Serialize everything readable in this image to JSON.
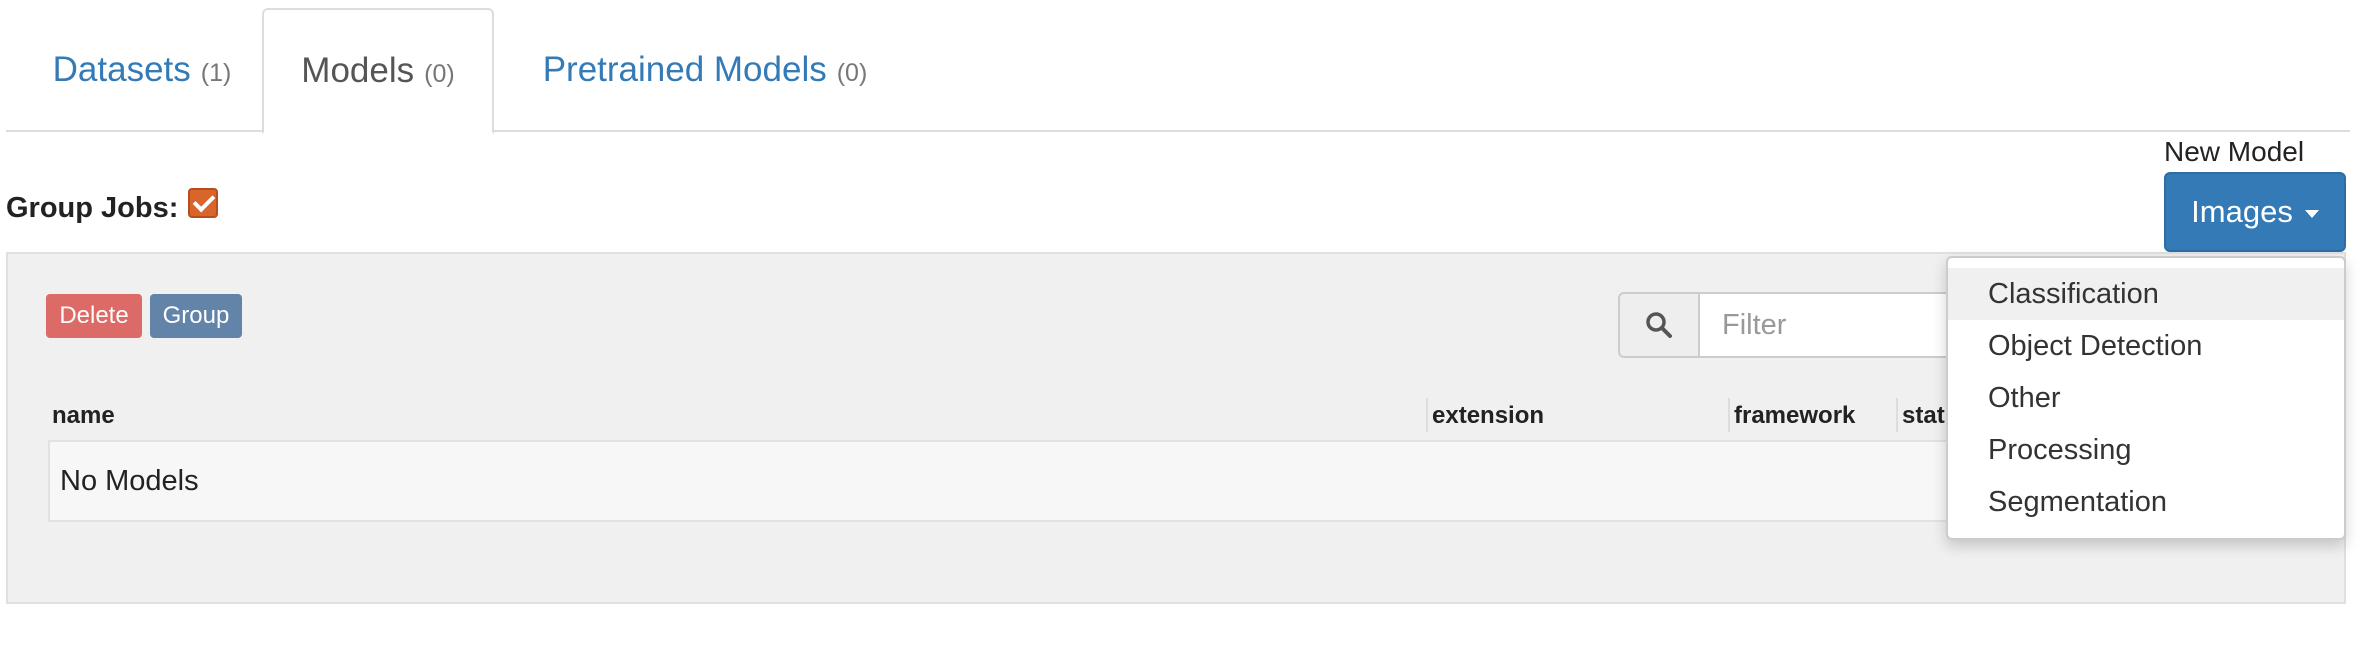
{
  "tabs": [
    {
      "label": "Datasets",
      "count": "(1)"
    },
    {
      "label": "Models",
      "count": "(0)"
    },
    {
      "label": "Pretrained Models",
      "count": "(0)"
    }
  ],
  "group_jobs": {
    "label": "Group Jobs:",
    "checked": true
  },
  "new_model": {
    "label": "New Model",
    "button_label": "Images"
  },
  "actions": {
    "delete_label": "Delete",
    "group_label": "Group"
  },
  "filter": {
    "placeholder": "Filter",
    "icon": "search-icon"
  },
  "table": {
    "columns": [
      "name",
      "extension",
      "framework",
      "stat"
    ],
    "empty_text": "No Models"
  },
  "dropdown": {
    "items": [
      "Classification",
      "Object Detection",
      "Other",
      "Processing",
      "Segmentation"
    ]
  },
  "colors": {
    "primary": "#337ab7",
    "danger": "#d9534f",
    "checkbox": "#d9652b"
  }
}
